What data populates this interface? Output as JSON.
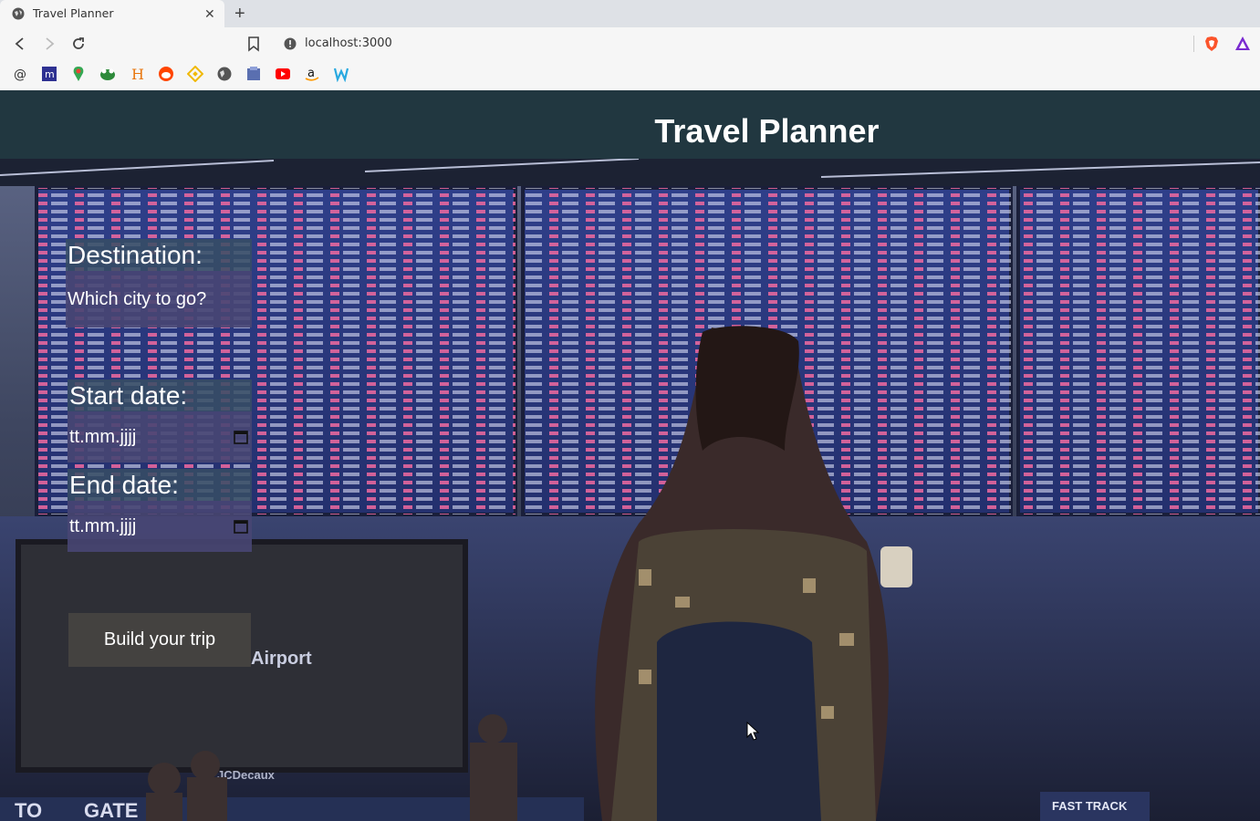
{
  "browser": {
    "tab_title": "Travel Planner",
    "url": "localhost:3000",
    "bookmarks": [
      "at-icon",
      "m-icon",
      "maps-icon",
      "frog-icon",
      "h-icon",
      "reddit-icon",
      "binance-icon",
      "globe-icon",
      "file-icon",
      "youtube-icon",
      "amazon-icon",
      "w-icon"
    ]
  },
  "app": {
    "title": "Travel Planner",
    "destination_label": "Destination:",
    "destination_placeholder": "Which city to go?",
    "start_label": "Start date:",
    "start_placeholder": "tt.mm.jjjj",
    "end_label": "End date:",
    "end_placeholder": "tt.mm.jjjj",
    "build_button": "Build your trip"
  },
  "background": {
    "signage": [
      "Airport",
      "FAST TRACK",
      "TO",
      "GATE",
      "JCDecaux"
    ]
  }
}
